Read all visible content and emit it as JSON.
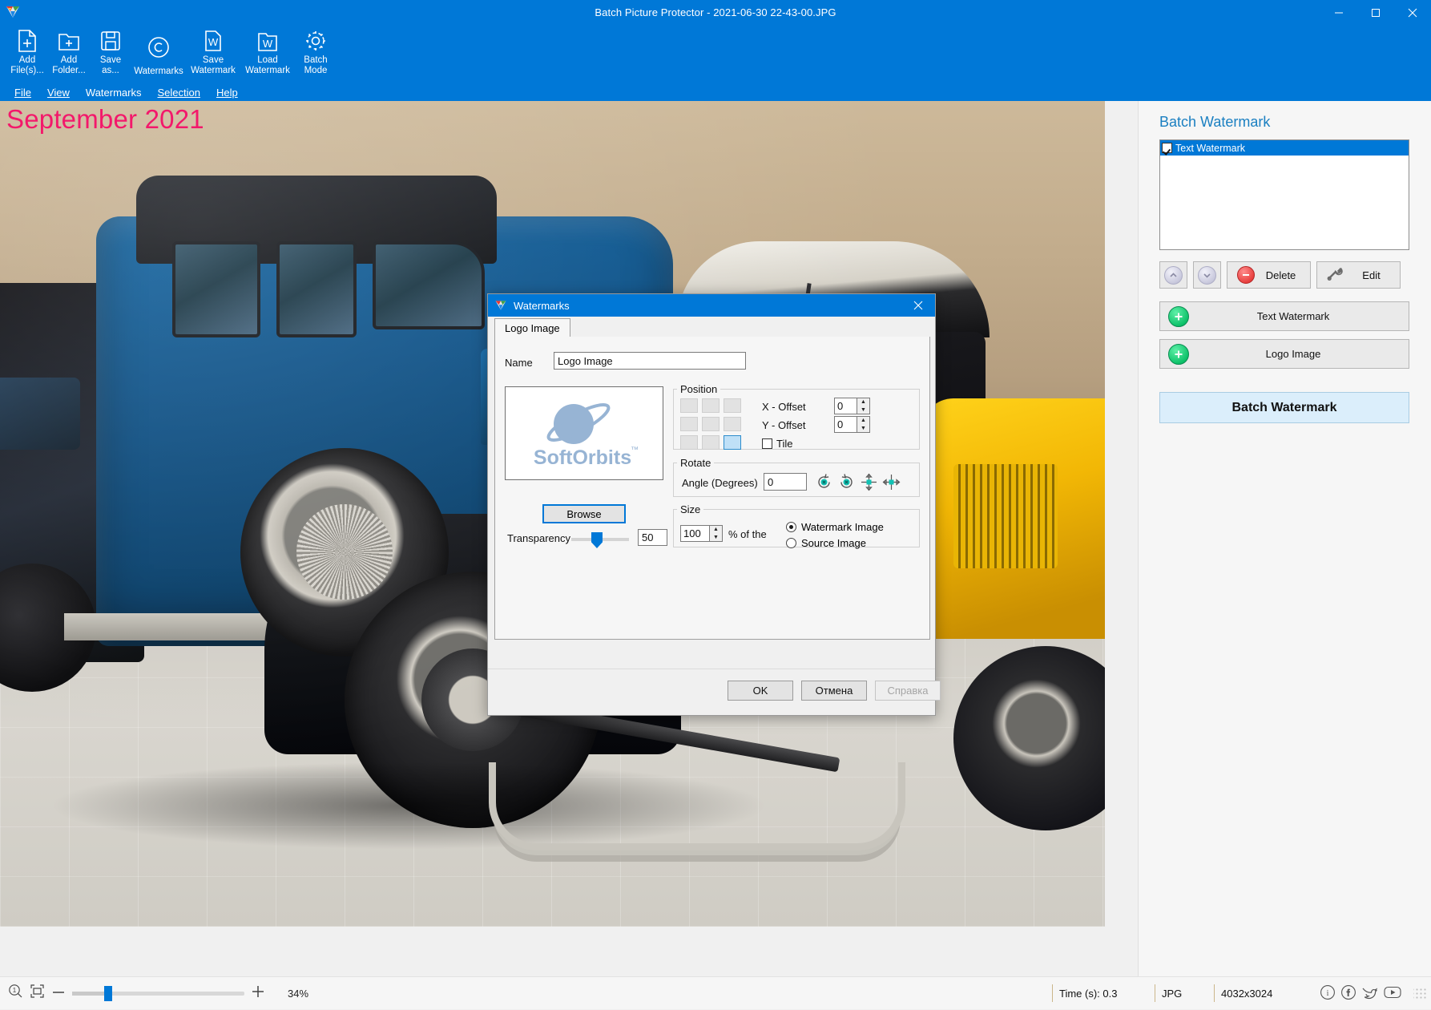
{
  "window": {
    "title": "Batch Picture Protector - 2021-06-30 22-43-00.JPG",
    "app_icon": "app-logo-icon",
    "minimize": "—",
    "maximize": "❑",
    "close": "✕"
  },
  "toolbar": {
    "items": [
      {
        "label": "Add\nFile(s)...",
        "icon": "add-file-icon",
        "name": "add-files"
      },
      {
        "label": "Add\nFolder...",
        "icon": "add-folder-icon",
        "name": "add-folder"
      },
      {
        "label": "Save\nas...",
        "icon": "save-as-icon",
        "name": "save-as"
      },
      {
        "label": "Watermarks",
        "icon": "copyright-icon",
        "name": "watermarks"
      },
      {
        "label": "Save\nWatermark",
        "icon": "save-watermark-icon",
        "name": "save-watermark"
      },
      {
        "label": "Load\nWatermark",
        "icon": "load-watermark-icon",
        "name": "load-watermark"
      },
      {
        "label": "Batch\nMode",
        "icon": "gear-icon",
        "name": "batch-mode"
      }
    ]
  },
  "menubar": {
    "items": [
      "File",
      "View",
      "Watermarks",
      "Selection",
      "Help"
    ]
  },
  "canvas": {
    "watermark_text": "September 2021",
    "watermark_color": "#f3186b"
  },
  "right_panel": {
    "title": "Batch Watermark",
    "list": [
      {
        "label": "Text Watermark",
        "checked": true,
        "selected": true
      }
    ],
    "move_up": "chevron-up-icon",
    "move_down": "chevron-down-icon",
    "delete_label": "Delete",
    "edit_label": "Edit",
    "add_text_watermark_label": "Text Watermark",
    "add_logo_image_label": "Logo Image",
    "batch_watermark_label": "Batch Watermark",
    "accent_color": "#1a7fc1",
    "batch_button_bg": "#dbeefb"
  },
  "dialog": {
    "title": "Watermarks",
    "close": "✕",
    "tab": "Logo Image",
    "name_label": "Name",
    "name_value": "Logo Image",
    "logo_preview_text": "SoftOrbits",
    "logo_preview_tm": "™",
    "browse_label": "Browse",
    "transparency_label": "Transparency",
    "transparency_value": "50",
    "position": {
      "legend": "Position",
      "x_offset_label": "X - Offset",
      "x_offset_value": "0",
      "y_offset_label": "Y - Offset",
      "y_offset_value": "0",
      "tile_label": "Tile",
      "tile_checked": false,
      "selected_cell": 8
    },
    "rotate": {
      "legend": "Rotate",
      "angle_label": "Angle (Degrees)",
      "angle_value": "0",
      "buttons": [
        "rotate-ccw-icon",
        "rotate-cw-icon",
        "flip-vertical-icon",
        "flip-horizontal-icon"
      ]
    },
    "size": {
      "legend": "Size",
      "value": "100",
      "pct_label": "% of the",
      "options": [
        "Watermark Image",
        "Source Image"
      ],
      "selected": "Watermark Image"
    },
    "footer": {
      "ok": "OK",
      "cancel": "Отмена",
      "help": "Справка"
    }
  },
  "statusbar": {
    "zoom_icon": "zoom-1-to-1-icon",
    "fit_icon": "fit-to-window-icon",
    "minus": "—",
    "plus": "+",
    "zoom_percent": "34%",
    "time": "Time (s): 0.3",
    "format": "JPG",
    "dimensions": "4032x3024",
    "social": [
      "info-icon",
      "facebook-icon",
      "twitter-icon",
      "youtube-icon"
    ]
  }
}
